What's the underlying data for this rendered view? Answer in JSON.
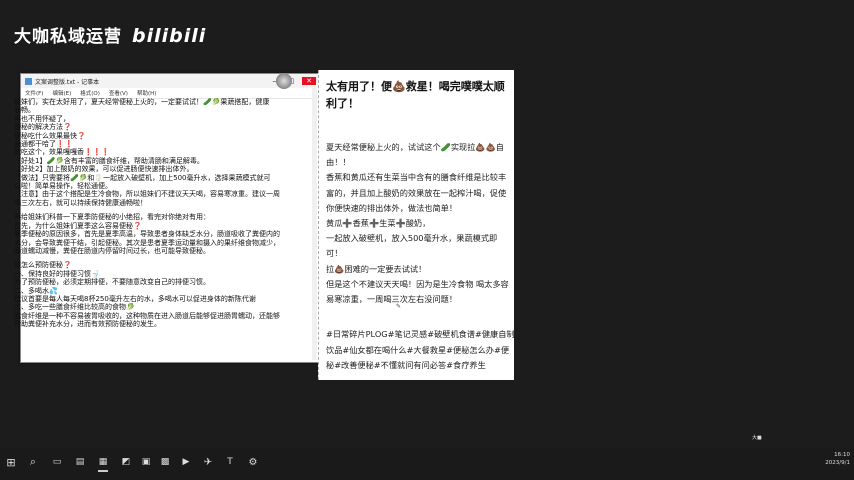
{
  "brand": {
    "name": "大咖私域运营",
    "logo": "bilibili"
  },
  "notepad": {
    "title": "文案调整版.txt - 记事本",
    "controls": {
      "minimize": "—",
      "maximize": "□",
      "close": "✕"
    },
    "menu": [
      "文件(F)",
      "编辑(E)",
      "格式(O)",
      "查看(V)",
      "帮助(H)"
    ],
    "lines": [
      "姐妹们，实在太好用了，夏天经常便秘上火的，一定要试试！🥒🥬果蔬搭配，健康",
      "通畅。",
      "再也不用怀疑了，",
      "便秘的解决方法❓",
      "便秘吃什么效果最快❓",
      "通通都干哈了❗❗",
      "就吃这个，效果嘎嘎香❗❗❗",
      "【好处1】🥒🥬含有丰富的膳食纤维，帮助清肠和满足解毒。",
      "【好处2】加上酸奶的效果，可以促进肠便快速排出体外。",
      "【做法】只需要将🥒🥬和🥛一起放入破壁机，加上500毫升水，选择果蔬模式就可",
      "以啦！简单易操作，轻松通便。",
      "【注意】由于这个搭配是生冷食物，所以姐妹们不建议天天喝，容易寒凉重。建议一周",
      "喝三次左右，就可以持续保持健康通畅啦！",
      "",
      "再给姐妹们科普一下夏季防便秘的小绝招，看完对你绝对有用：",
      "首先，为什么姐妹们夏季这么容易便秘❓",
      "夏季便秘的原因很多，首先是夏季高温，导致患者身体缺乏水分，肠道吸收了粪便内的",
      "水分，会导致粪便干结，引起便秘。其次是患者夏季运动量和摄入的果纤维食物减少，",
      "肠道蠕动减慢，粪便在肠道内停留时间过长，也可能导致便秘。",
      "",
      "该怎么预防便秘❓",
      "一、保持良好的排便习惯🚽",
      "为了预防便秘，必须定期排便，不要随意改变自己的排便习惯。",
      "二、多喝水💦",
      "建议首要是每人每天喝8杯250毫升左右的水，多喝水可以促进身体的新陈代谢",
      "三、多吃一些膳食纤维比较高的食物🥬",
      "膳食纤维是一种不容易被胃吸收的，这种物质在进入肠道后能够促进肠胃蠕动，还能够",
      "帮助粪便补充水分，进而有效预防便秘的发生。"
    ]
  },
  "post": {
    "title": "太有用了！便💩救星！喝完噗噗太顺利了！",
    "body": [
      "夏天经常便秘上火的，试试这个🥒实现拉💩💩自",
      "由！！",
      "香蕉和黄瓜还有生菜当中含有的膳食纤维是比较丰",
      "富的，并且加上酸奶的效果放在一起榨汁喝，促使",
      "你便快速的排出体外，做法也简单！",
      "黄瓜➕香蕉➕生菜➕酸奶，",
      "一起放入破壁机，放入500毫升水，果蔬模式即",
      "可！",
      "拉💩困难的一定要去试试！",
      "但是这个不建议天天喝！因为是生冷食物 喝太多容",
      "易寒凉重，一周喝三次左右没问题！"
    ],
    "tags": [
      "#日常碎片PLOG#笔记灵感#破壁机食谱#健康自制",
      "饮品#仙女都在喝什么#大餐救星#便秘怎么办#便",
      "秘#改善便秘#不懂就问有问必答#食疗养生"
    ],
    "pen_icon": "pen-icon"
  },
  "taskbar": {
    "icons": [
      "windows-icon",
      "search-icon",
      "task-view-icon",
      "notepad-icon",
      "file-explorer-icon",
      "photos-icon",
      "store-icon",
      "app-icon",
      "video-icon",
      "maps-icon",
      "typora-icon",
      "settings-icon"
    ],
    "time": "16:10",
    "date": "2023/9/1",
    "tray_badge": "大■"
  },
  "colors": {
    "background": "#1c1c1c",
    "close_red": "#e81123",
    "taskbar": "#1a1a1a"
  }
}
